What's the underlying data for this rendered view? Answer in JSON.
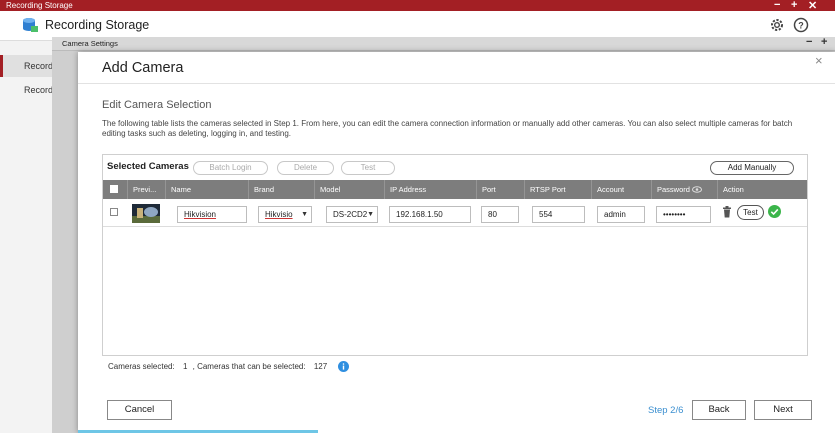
{
  "outer": {
    "title": "Recording Storage",
    "controls": [
      "−",
      "+",
      "✕"
    ]
  },
  "app": {
    "title": "Recording Storage",
    "nav": [
      {
        "label": "Recordi",
        "active": true
      },
      {
        "label": "Recordi",
        "active": false
      }
    ],
    "settings_icon": "gear-icon",
    "help_icon": "question-circle-icon"
  },
  "camera_window": {
    "title": "Camera Settings",
    "controls": [
      "−",
      "+"
    ]
  },
  "dialog": {
    "title": "Add Camera",
    "close": "×",
    "section_title": "Edit Camera Selection",
    "description": "The following table lists the cameras selected in Step 1. From here, you can edit the camera connection information or manually add other cameras. You can also select multiple cameras for batch editing tasks such as deleting, logging in, and testing.",
    "panel": {
      "title": "Selected Cameras",
      "batch_login": "Batch Login",
      "delete": "Delete",
      "test": "Test",
      "add_manually": "Add Manually",
      "columns": [
        "Previ...",
        "Name",
        "Brand",
        "Model",
        "IP Address",
        "Port",
        "RTSP Port",
        "Account",
        "Password",
        "Action"
      ],
      "rows": [
        {
          "name": "Hikvision",
          "brand": "Hikvisio",
          "model": "DS-2CD2",
          "ip": "192.168.1.50",
          "port": "80",
          "rtsp_port": "554",
          "account": "admin",
          "password": "••••••••",
          "test_label": "Test",
          "status": "ok"
        }
      ]
    },
    "cameras_selected_label": "Cameras selected:",
    "cameras_selected_value": "1",
    "cameras_available_label": ", Cameras that can be selected:",
    "cameras_available_value": "127",
    "cancel": "Cancel",
    "step": "Step 2/6",
    "back": "Back",
    "next": "Next"
  }
}
